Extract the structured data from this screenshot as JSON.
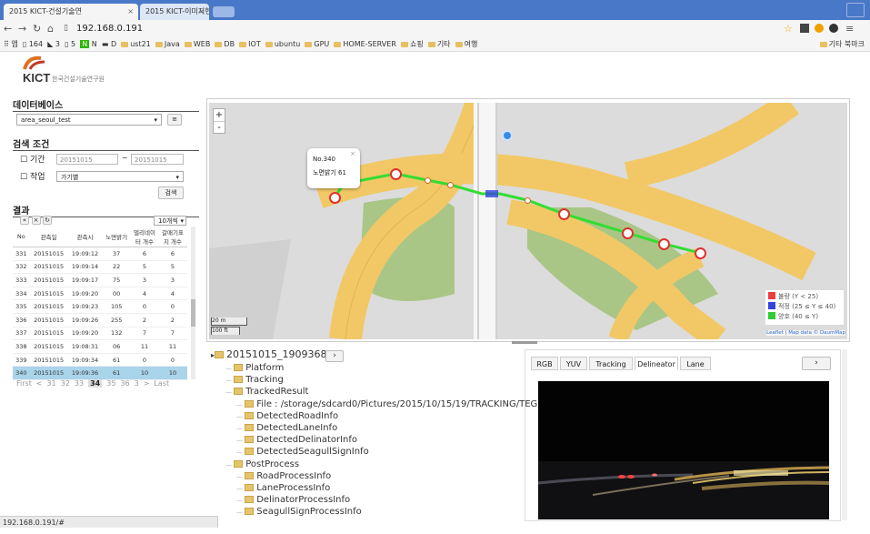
{
  "browser": {
    "tabs": [
      {
        "label": "2015 KICT-건설기술연"
      },
      {
        "label": "2015 KICT-이미지현"
      }
    ],
    "url": "192.168.0.191",
    "bookmarks": [
      "앱",
      "164",
      "3",
      "5",
      "N",
      "D",
      "ust21",
      "Java",
      "WEB",
      "DB",
      "IOT",
      "ubuntu",
      "GPU",
      "HOME-SERVER",
      "쇼핑",
      "기타",
      "여행"
    ],
    "other_bookmarks": "기타 북마크"
  },
  "header": {
    "logo": "KICT",
    "logo_sub": "한국건설기술연구원"
  },
  "left": {
    "db_title": "데이터베이스",
    "db_select": "area_seoul_test",
    "search_title": "검색 조건",
    "period_label": "기간",
    "date_from": "20151015",
    "date_sep": "~",
    "date_to": "20151015",
    "job_label": "작업",
    "job_select": "가기별",
    "search_button": "검색",
    "results_title": "결과",
    "page_size": "10개씩",
    "columns": [
      "No",
      "관측일",
      "관측시",
      "노면밝기",
      "델리네이터 개수",
      "갈매기표지 개수"
    ],
    "rows": [
      [
        "331",
        "20151015",
        "19:09:12",
        "37",
        "6",
        "6"
      ],
      [
        "332",
        "20151015",
        "19:09:14",
        "22",
        "5",
        "5"
      ],
      [
        "333",
        "20151015",
        "19:09:17",
        "75",
        "3",
        "3"
      ],
      [
        "334",
        "20151015",
        "19:09:20",
        "00",
        "4",
        "4"
      ],
      [
        "335",
        "20151015",
        "19:09:23",
        "105",
        "0",
        "0"
      ],
      [
        "336",
        "20151015",
        "19:09:26",
        "255",
        "2",
        "2"
      ],
      [
        "337",
        "20151015",
        "19:09:20",
        "132",
        "7",
        "7"
      ],
      [
        "338",
        "20151015",
        "19:08:31",
        "06",
        "11",
        "11"
      ],
      [
        "339",
        "20151015",
        "19:09:34",
        "61",
        "0",
        "0"
      ],
      [
        "340",
        "20151015",
        "19:09:36",
        "61",
        "10",
        "10"
      ]
    ],
    "selected_row": 9,
    "pagination": [
      "First",
      "<",
      "31",
      "32",
      "33",
      "34",
      "35",
      "36",
      "3",
      ">",
      "Last"
    ],
    "current_page": "34"
  },
  "map": {
    "popup_title": "No.340",
    "popup_text": "노면밝기 61",
    "zoom_in": "+",
    "zoom_out": "-",
    "scale_top": "20 m",
    "scale_bottom": "100 ft",
    "legend": [
      {
        "label": "불량 (Y < 25)",
        "color": "#e84040"
      },
      {
        "label": "적정 (25 ≤ Y ≤ 40)",
        "color": "#3344dd"
      },
      {
        "label": "양호 (40 ≤ Y)",
        "color": "#33cc33"
      }
    ],
    "attribution": "Leaflet | Map data © DaumMap"
  },
  "tree": {
    "root": "20151015_190936880",
    "root_button": "›",
    "items": [
      {
        "label": "Platform",
        "level": 1
      },
      {
        "label": "Tracking",
        "level": 1
      },
      {
        "label": "TrackedResult",
        "level": 1
      },
      {
        "label": "File : /storage/sdcard0/Pictures/2015/10/15/19/TRACKING/TEGRA7_TR",
        "level": 2
      },
      {
        "label": "DetectedRoadInfo",
        "level": 2
      },
      {
        "label": "DetectedLaneInfo",
        "level": 2
      },
      {
        "label": "DetectedDelinatorInfo",
        "level": 2
      },
      {
        "label": "DetectedSeagullSignInfo",
        "level": 2
      },
      {
        "label": "PostProcess",
        "level": 1
      },
      {
        "label": "RoadProcessInfo",
        "level": 2
      },
      {
        "label": "LaneProcessInfo",
        "level": 2
      },
      {
        "label": "DelinatorProcessInfo",
        "level": 2
      },
      {
        "label": "SeagullSignProcessInfo",
        "level": 2
      }
    ]
  },
  "viewer": {
    "tabs": [
      "RGB",
      "YUV",
      "Tracking",
      "Delineator",
      "Lane"
    ],
    "active_tab": "Delineator",
    "next_button": "›"
  },
  "status": "192.168.0.191/#",
  "colors": {
    "chrome": "#4a78c8",
    "selected_row": "#a9d4ea",
    "road": "#f2c866",
    "grass": "#a9c686"
  }
}
